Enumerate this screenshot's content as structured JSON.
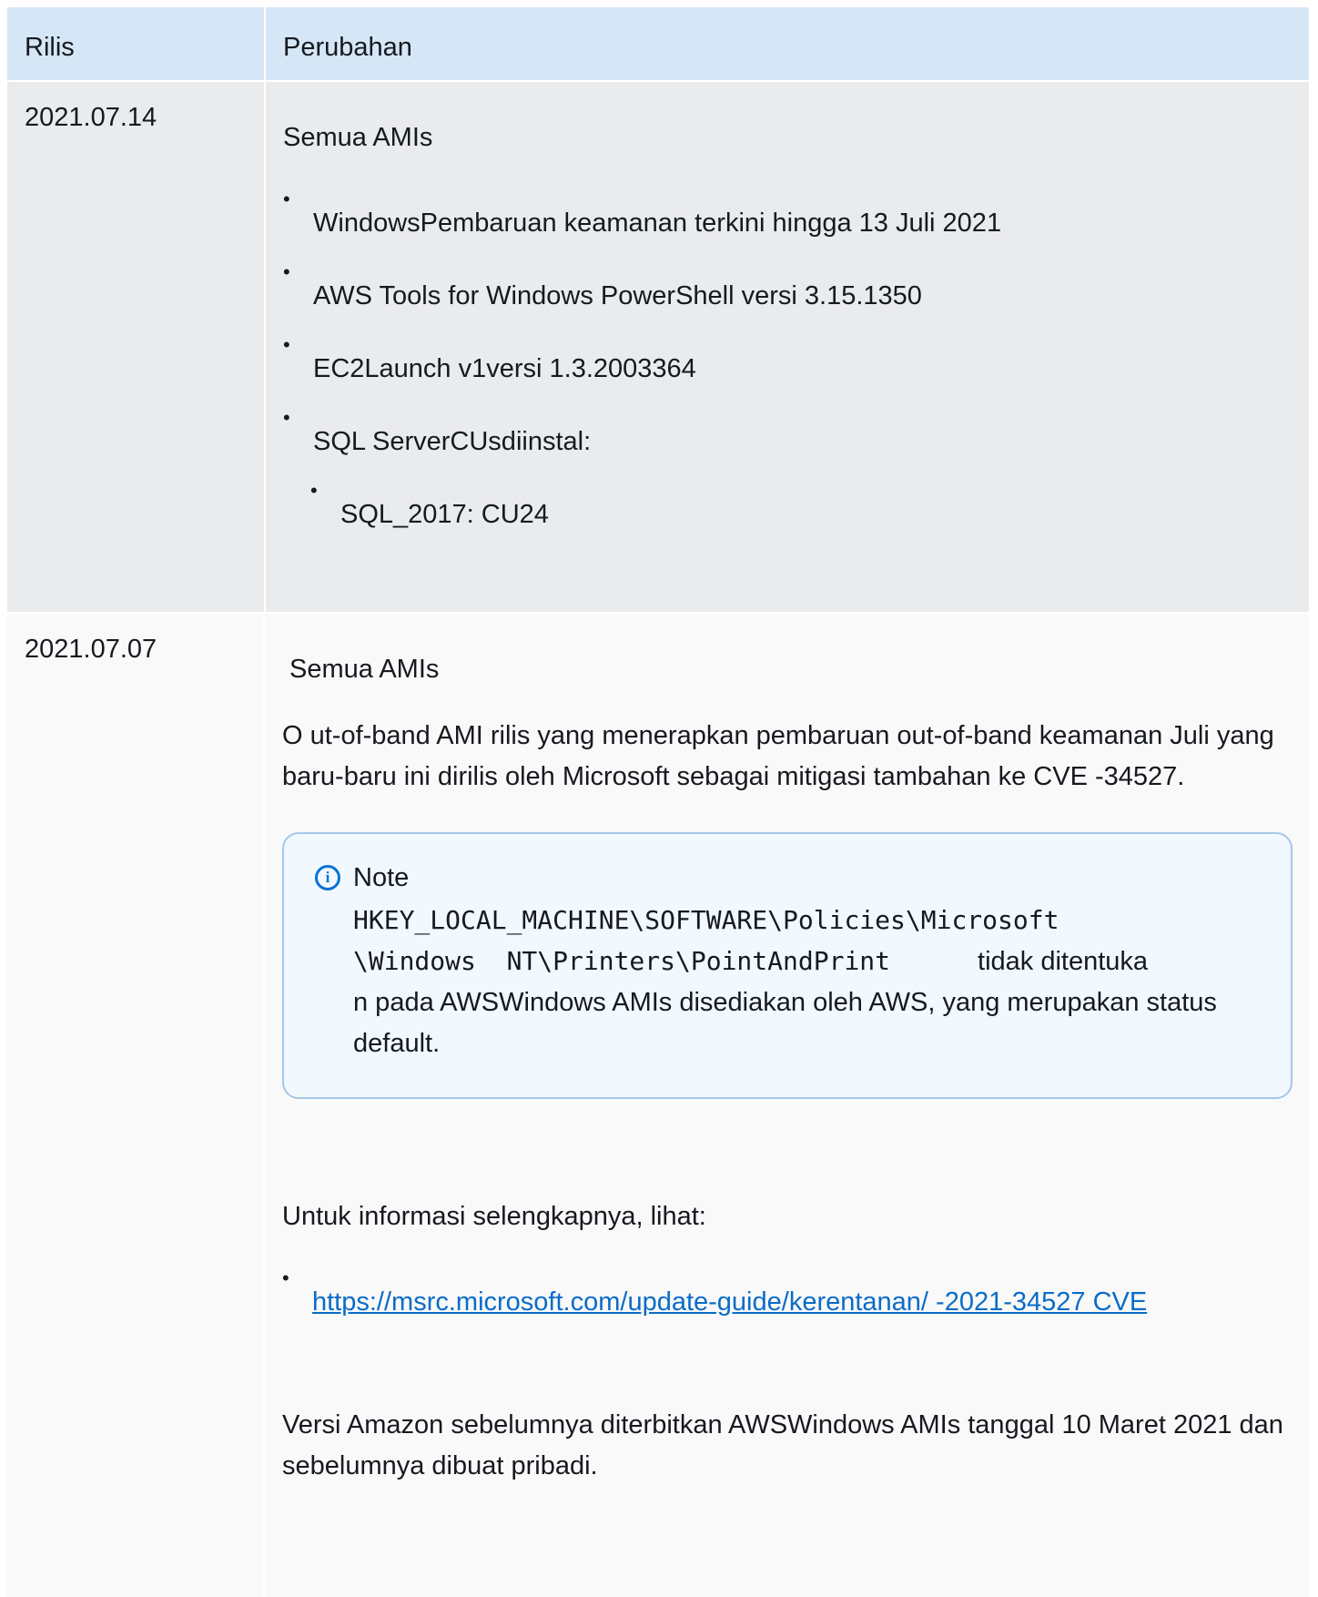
{
  "header": {
    "rilis": "Rilis",
    "perubahan": "Perubahan"
  },
  "rows": [
    {
      "release": "2021.07.14",
      "section_title": "Semua AMIs",
      "bullets": [
        "WindowsPembaruan keamanan terkini hingga 13 Juli 2021",
        "AWS Tools for Windows PowerShell versi 3.15.1350",
        "EC2Launch v1versi 1.3.2003364",
        "SQL ServerCUsdiinstal:"
      ],
      "sub_bullets": [
        "SQL_2017: CU24"
      ]
    },
    {
      "release": "2021.07.07",
      "section_title": "Semua AMIs",
      "paragraph_1": "O ut-of-band AMI rilis yang menerapkan pembaruan out-of-band keamanan Juli yang baru-baru ini dirilis oleh Microsoft sebagai mitigasi tambahan ke CVE -34527.",
      "note": {
        "title": "Note",
        "registry_line_1": "HKEY_LOCAL_MACHINE\\SOFTWARE\\Policies\\Microsoft",
        "registry_line_2": "\\Windows  NT\\Printers\\PointAndPrint",
        "text_1": "tidak ditentuka",
        "text_2": "n pada AWSWindows AMIs disediakan oleh AWS, yang merupakan status default."
      },
      "more_info": "Untuk informasi selengkapnya, lihat:",
      "link_text": "https://msrc.microsoft.com/update-guide/kerentanan/ -2021-34527 CVE",
      "paragraph_2": "Versi Amazon sebelumnya diterbitkan AWSWindows AMIs tanggal 10 Maret 2021 dan sebelumnya dibuat pribadi."
    }
  ],
  "colors": {
    "header_bg": "#d5e7f7",
    "row1_bg": "#eaebed",
    "row2_bg": "#f9f9f9",
    "note_border": "#a5c8e8",
    "note_bg": "#f1f8fe",
    "link": "#0a6cc8",
    "info_icon": "#0972d3"
  }
}
